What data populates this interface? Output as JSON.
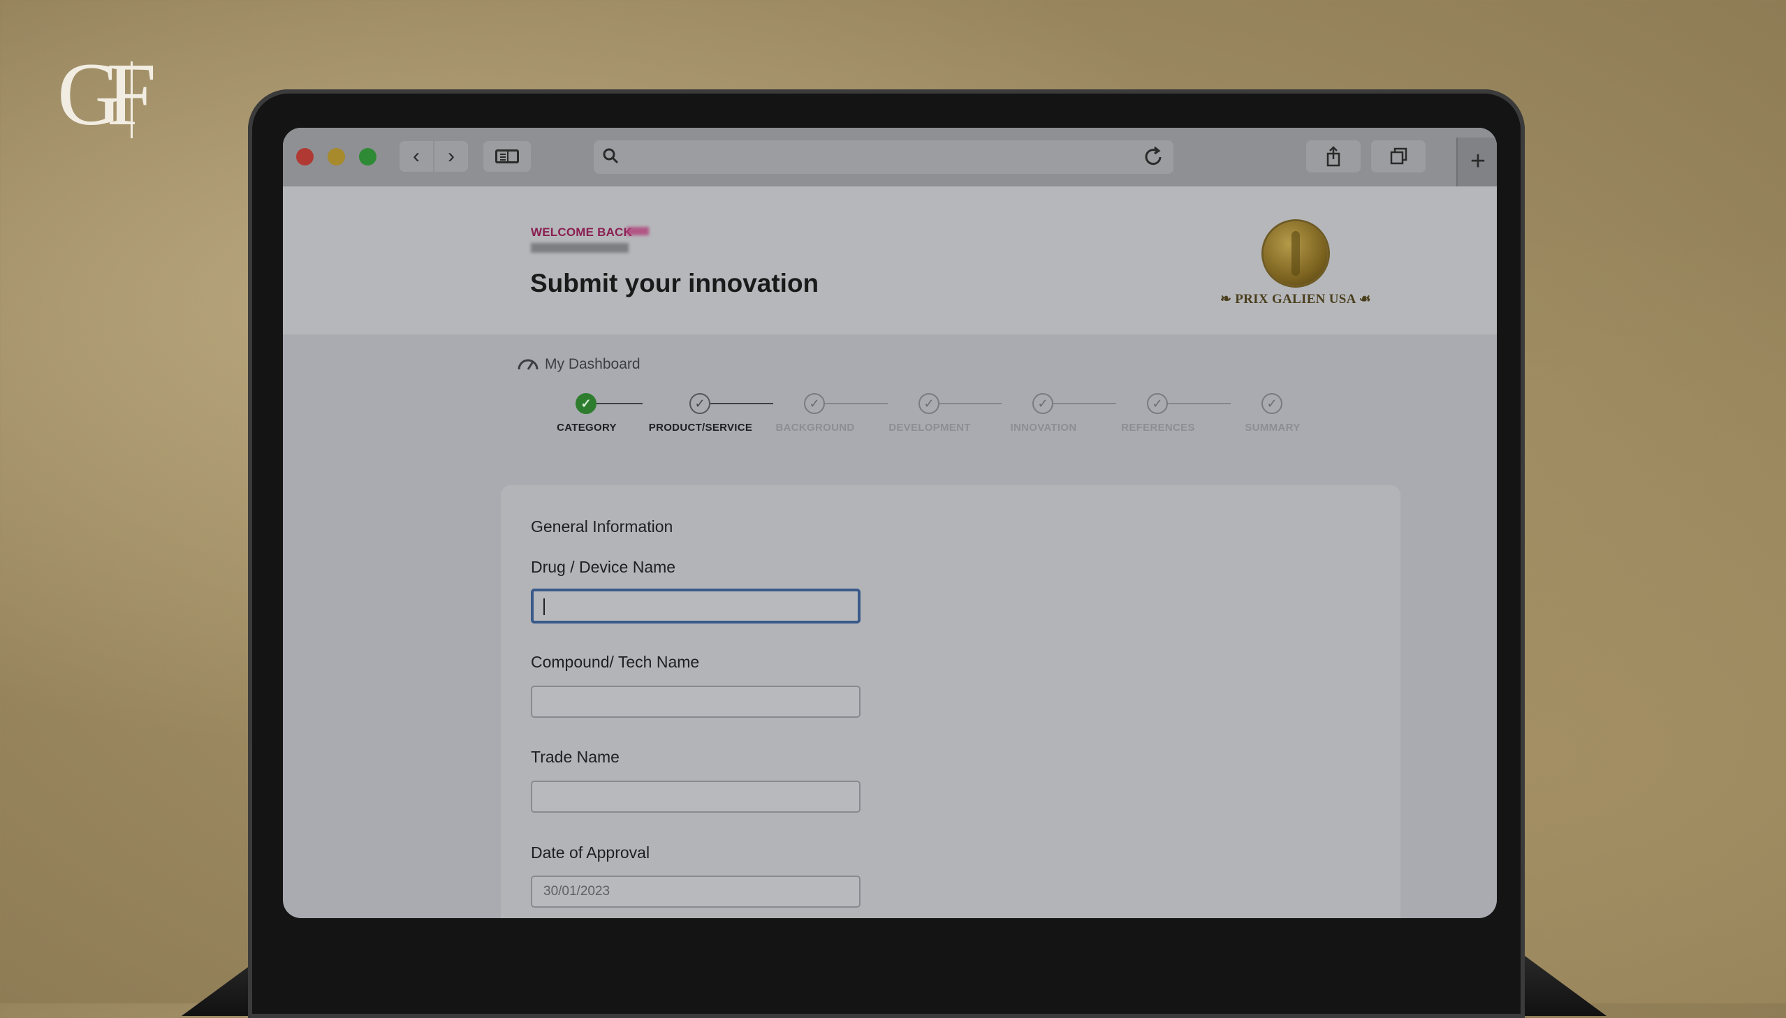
{
  "brand_logo": {
    "text": "GF"
  },
  "browser": {
    "back_label": "‹",
    "forward_label": "›",
    "new_tab_label": "+"
  },
  "header": {
    "welcome": "WELCOME BACK",
    "title": "Submit your innovation",
    "prize_name": "PRIX GALIEN USA"
  },
  "dashboard_link": "My Dashboard",
  "steps": [
    {
      "label": "CATEGORY",
      "state": "done",
      "mark": "✓"
    },
    {
      "label": "PRODUCT/SERVICE",
      "state": "active",
      "mark": "✓"
    },
    {
      "label": "BACKGROUND",
      "state": "pending",
      "mark": "✓"
    },
    {
      "label": "DEVELOPMENT",
      "state": "pending",
      "mark": "✓"
    },
    {
      "label": "INNOVATION",
      "state": "pending",
      "mark": "✓"
    },
    {
      "label": "REFERENCES",
      "state": "pending",
      "mark": "✓"
    },
    {
      "label": "SUMMARY",
      "state": "pending",
      "mark": "✓"
    }
  ],
  "form": {
    "section_title": "General Information",
    "drug_label": "Drug / Device Name",
    "drug_value": "",
    "compound_label": "Compound/ Tech Name",
    "compound_value": "",
    "trade_label": "Trade Name",
    "trade_value": "",
    "date_label": "Date of Approval",
    "date_value": "30/01/2023"
  },
  "colors": {
    "step_done": "#2e7d2e",
    "welcome_text": "#8a1f52",
    "focus_border": "#3a5a8a"
  }
}
